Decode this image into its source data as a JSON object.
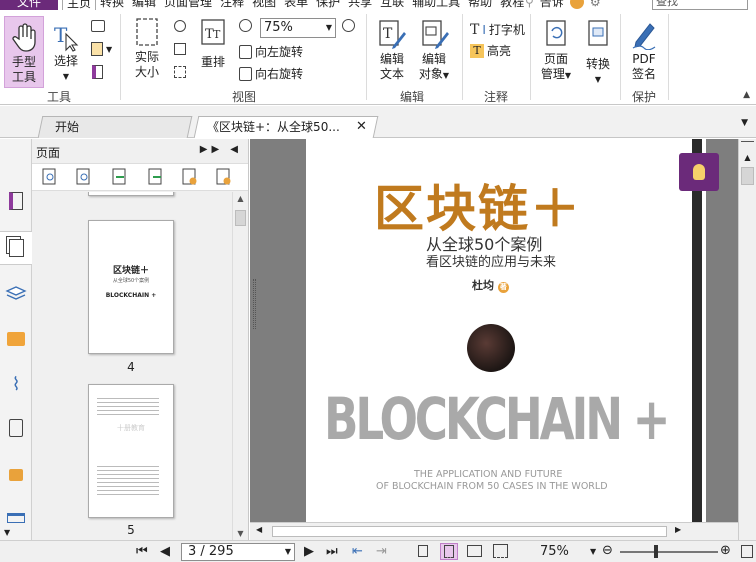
{
  "menu": {
    "file": "文件",
    "tabs": [
      "主页",
      "转换",
      "编辑",
      "页面管理",
      "注释",
      "视图",
      "表单",
      "保护",
      "共享",
      "互联",
      "辅助工具",
      "帮助",
      "教程"
    ],
    "active_tab": "主页",
    "tell_me": "告诉",
    "search_placeholder": "查找"
  },
  "ribbon": {
    "groups": {
      "tools": "工具",
      "view": "视图",
      "edit": "编辑",
      "comment": "注释",
      "protect": "保护"
    },
    "hand_tool": [
      "手型",
      "工具"
    ],
    "select": "选择",
    "actual_size": [
      "实际",
      "大小"
    ],
    "reflow": "重排",
    "zoom_value": "75%",
    "rotate_left": "向左旋转",
    "rotate_right": "向右旋转",
    "edit_text": [
      "编辑",
      "文本"
    ],
    "edit_object": [
      "编辑",
      "对象"
    ],
    "typewriter": "打字机",
    "highlight": "高亮",
    "page_manage": [
      "页面",
      "管理"
    ],
    "convert": "转换",
    "pdf_sign": [
      "PDF",
      "签名"
    ]
  },
  "doc_tabs": [
    {
      "label": "开始",
      "active": false
    },
    {
      "label": "《区块链+：从全球50...",
      "active": true,
      "close": "✕"
    }
  ],
  "panel": {
    "title": "页面",
    "thumbnails": [
      {
        "number": "4",
        "title": "区块链＋",
        "subtitle": "从全球50个案例",
        "brand": "BLOCKCHAIN +"
      },
      {
        "number": "5",
        "stamp": "十册教育"
      }
    ]
  },
  "page": {
    "title": "区块链＋",
    "subtitle1": "从全球50个案例",
    "subtitle2": "看区块链的应用与未来",
    "author": "杜均",
    "author_mark": "著",
    "brand": "BLOCKCHAIN +",
    "tagline1": "THE APPLICATION AND FUTURE",
    "tagline2": "OF BLOCKCHAIN FROM 50 CASES IN THE WORLD"
  },
  "status": {
    "page_indicator": "3 / 295",
    "zoom": "75%"
  },
  "colors": {
    "accent": "#6b2a7a",
    "title_orange": "#c07a1e",
    "selected_bg": "#e8c7ec"
  }
}
